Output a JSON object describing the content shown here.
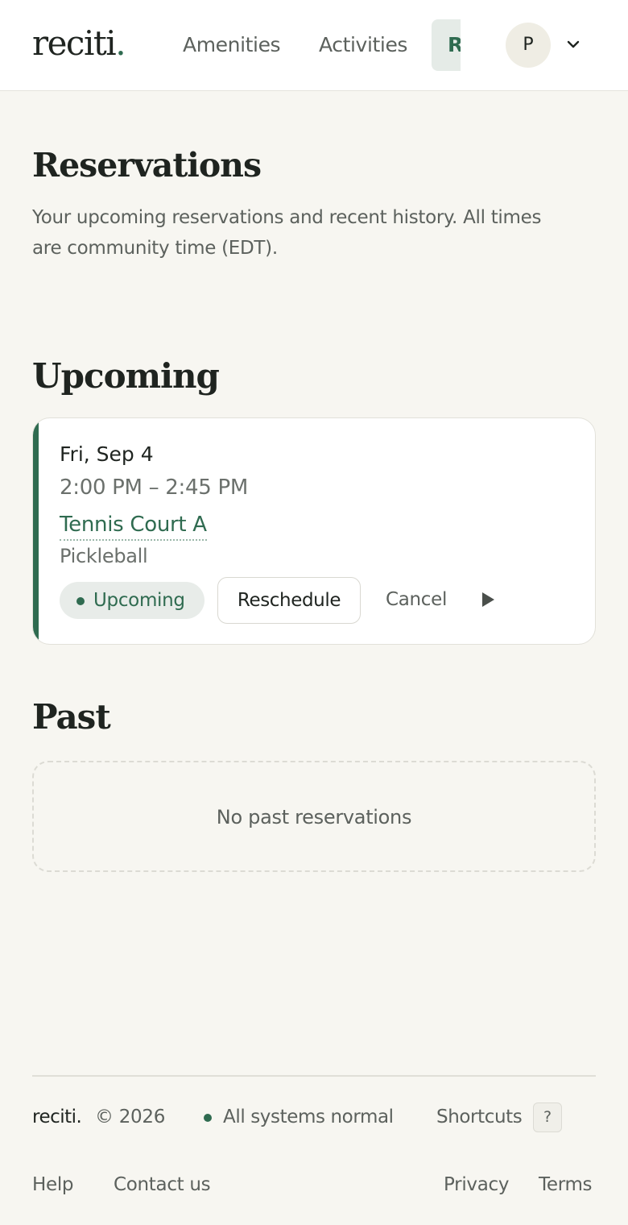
{
  "header": {
    "logo_text": "reciti",
    "logo_dot": ".",
    "nav": {
      "amenities": "Amenities",
      "activities": "Activities",
      "reservations_partial": "R"
    },
    "avatar_initial": "P",
    "chevron_icon": "chevron-down-icon"
  },
  "page": {
    "title": "Reservations",
    "description": "Your upcoming reservations and recent history. All times are community time (EDT)."
  },
  "upcoming": {
    "heading": "Upcoming",
    "items": [
      {
        "date": "Fri, Sep 4",
        "time": "2:00 PM – 2:45 PM",
        "place": "Tennis Court A",
        "activity": "Pickleball",
        "status": "Upcoming",
        "reschedule_label": "Reschedule",
        "cancel_label": "Cancel",
        "more_icon": "play-icon"
      }
    ]
  },
  "past": {
    "heading": "Past",
    "empty_message": "No past reservations"
  },
  "footer": {
    "brand": "reciti.",
    "copyright": "© 2026",
    "status": "All systems normal",
    "shortcuts_label": "Shortcuts",
    "shortcuts_key": "?",
    "links": {
      "help": "Help",
      "contact": "Contact us",
      "privacy": "Privacy",
      "terms": "Terms"
    }
  },
  "colors": {
    "brand": "#2f6b50",
    "background": "#f7f6f1",
    "text": "#1f2420",
    "muted_text": "#5c615d"
  }
}
